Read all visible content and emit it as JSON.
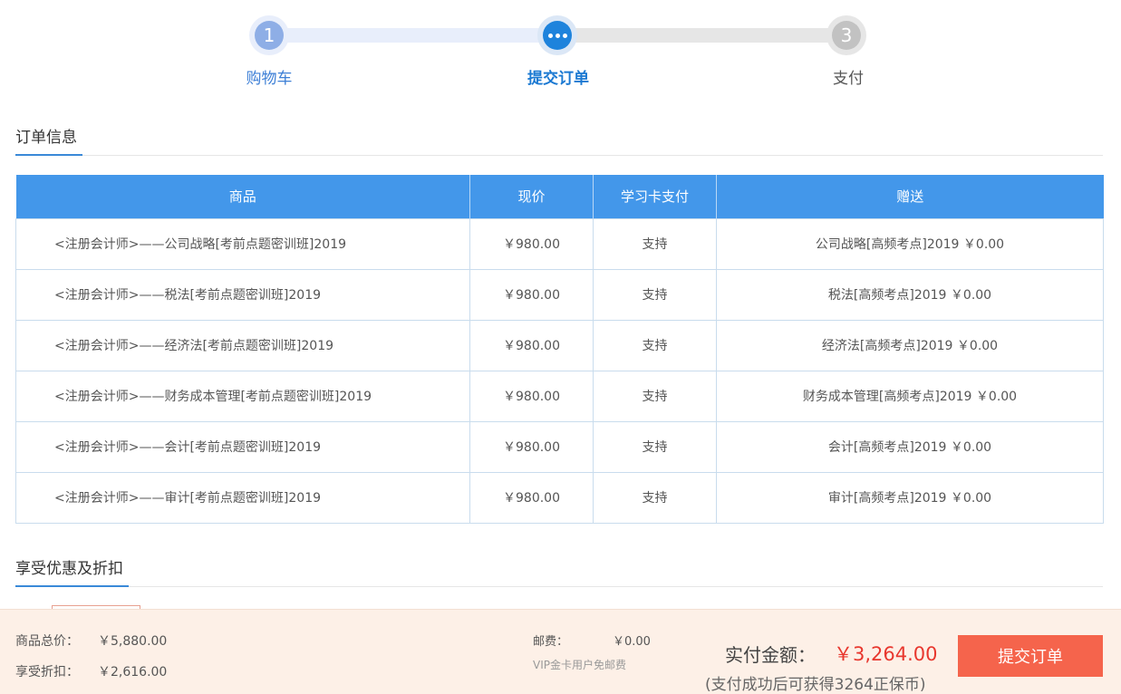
{
  "stepper": {
    "steps": [
      {
        "number": "1",
        "label": "购物车"
      },
      {
        "number": "",
        "label": "提交订单"
      },
      {
        "number": "3",
        "label": "支付"
      }
    ]
  },
  "order_info": {
    "title": "订单信息",
    "columns": [
      "商品",
      "现价",
      "学习卡支付",
      "赠送"
    ],
    "rows": [
      {
        "product": "<注册会计师>——公司战略[考前点题密训班]2019",
        "price": "￥980.00",
        "card_pay": "支持",
        "gift": "公司战略[高频考点]2019  ￥0.00"
      },
      {
        "product": "<注册会计师>——税法[考前点题密训班]2019",
        "price": "￥980.00",
        "card_pay": "支持",
        "gift": "税法[高频考点]2019  ￥0.00"
      },
      {
        "product": "<注册会计师>——经济法[考前点题密训班]2019",
        "price": "￥980.00",
        "card_pay": "支持",
        "gift": "经济法[高频考点]2019  ￥0.00"
      },
      {
        "product": "<注册会计师>——财务成本管理[考前点题密训班]2019",
        "price": "￥980.00",
        "card_pay": "支持",
        "gift": "财务成本管理[高频考点]2019  ￥0.00"
      },
      {
        "product": "<注册会计师>——会计[考前点题密训班]2019",
        "price": "￥980.00",
        "card_pay": "支持",
        "gift": "会计[高频考点]2019  ￥0.00"
      },
      {
        "product": "<注册会计师>——审计[考前点题密训班]2019",
        "price": "￥980.00",
        "card_pay": "支持",
        "gift": "审计[高频考点]2019  ￥0.00"
      }
    ]
  },
  "discount": {
    "title": "享受优惠及折扣"
  },
  "footer": {
    "total_label": "商品总价：",
    "total_value": "￥5,880.00",
    "discount_label": "享受折扣：",
    "discount_value": "￥2,616.00",
    "shipping_label": "邮费：",
    "shipping_value": "￥0.00",
    "shipping_note": "VIP金卡用户免邮费",
    "pay_label": "实付金额：",
    "pay_value": "￥3,264.00",
    "pay_note": "(支付成功后可获得3264正保币)",
    "submit_label": "提交订单"
  },
  "colors": {
    "primary": "#4397ea",
    "accent": "#f5644c",
    "price_red": "#e8372e",
    "footer_bg": "#fdf0e7"
  }
}
